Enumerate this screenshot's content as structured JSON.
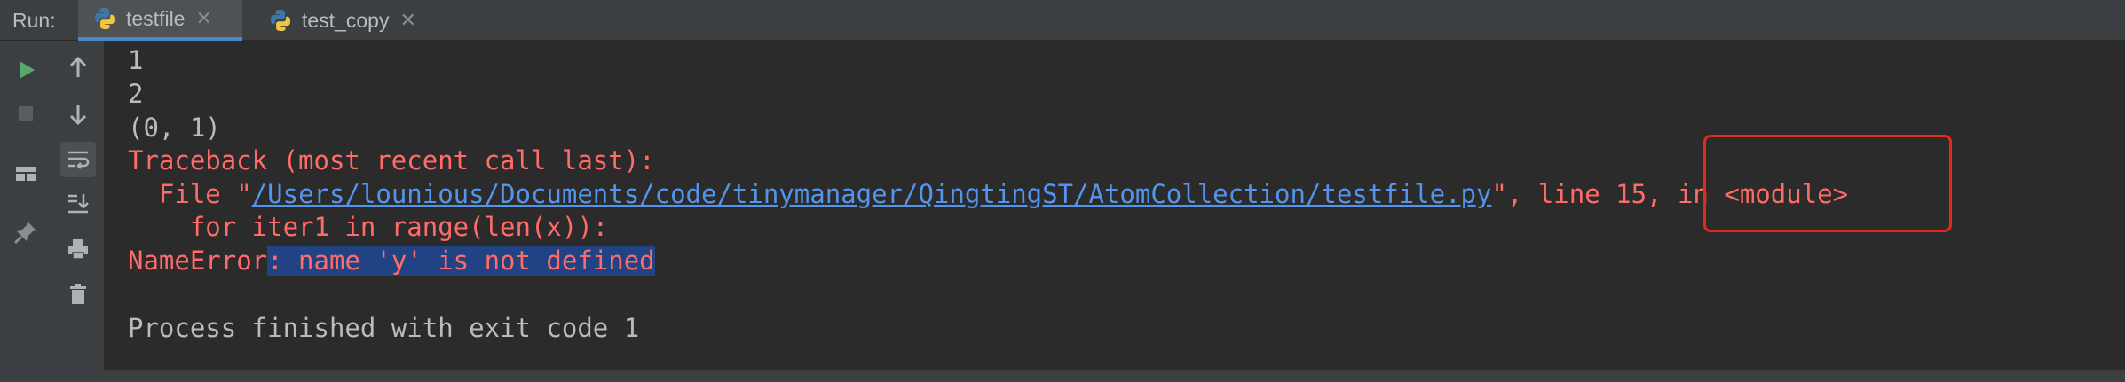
{
  "run_panel": {
    "label": "Run:",
    "tabs": [
      {
        "label": "testfile",
        "close": "✕"
      },
      {
        "label": "test_copy",
        "close": "✕"
      }
    ]
  },
  "toolbar": {
    "left": [
      "run-icon",
      "stop-icon",
      "layout-icon",
      "pin-icon"
    ],
    "right": [
      "arrow-up-icon",
      "arrow-down-icon",
      "soft-wrap-icon",
      "scroll-to-end-icon",
      "print-icon",
      "trash-icon"
    ]
  },
  "console": {
    "line1": "1",
    "line2": "2",
    "line3": "(0, 1)",
    "traceback_header": "Traceback (most recent call last):",
    "file_prefix": "  File \"",
    "file_path": "/Users/lounious/Documents/code/tinymanager/QingtingST/AtomCollection/testfile.py",
    "file_quote": "\"",
    "file_suffix": ", line 15, in ",
    "module": "<module>",
    "code_line": "    for iter1 in range(len(x)):",
    "error_name": "NameError",
    "error_message": ": name 'y' is not defined",
    "exit_message": "Process finished with exit code 1"
  },
  "colors": {
    "error_text": "#ff6b68",
    "link": "#5394ec",
    "selection": "#214283",
    "annotation_box": "#e8271b"
  }
}
